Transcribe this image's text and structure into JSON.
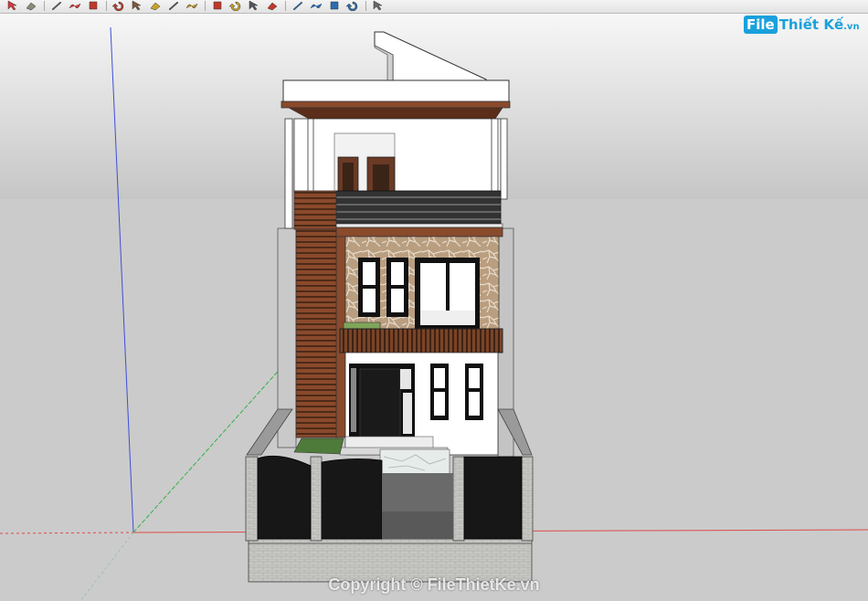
{
  "toolbar": {
    "tools": [
      {
        "icon": "select-arrow-icon",
        "color": "#d23a3a"
      },
      {
        "icon": "eraser-icon",
        "color": "#8a8a7a"
      },
      {
        "icon": "line-pencil-icon",
        "color": "#606060"
      },
      {
        "icon": "freehand-icon",
        "color": "#c23b3b"
      },
      {
        "icon": "push-pull-icon",
        "color": "#c0392b"
      },
      {
        "icon": "rotate-icon",
        "color": "#c0392b"
      },
      {
        "icon": "paint-bucket-icon",
        "color": "#7a5a3a"
      },
      {
        "icon": "tape-measure-icon",
        "color": "#c9a227"
      },
      {
        "icon": "dimension-icon",
        "color": "#555555"
      },
      {
        "icon": "text-icon",
        "color": "#b08a2a"
      },
      {
        "icon": "orbit-icon",
        "color": "#c0392b"
      },
      {
        "icon": "pan-hand-icon",
        "color": "#c9a227"
      },
      {
        "icon": "zoom-icon",
        "color": "#555555"
      },
      {
        "icon": "zoom-extents-icon",
        "color": "#c0392b"
      },
      {
        "icon": "previous-view-icon",
        "color": "#2b6cb0"
      },
      {
        "icon": "next-view-icon",
        "color": "#2b6cb0"
      },
      {
        "icon": "position-camera-icon",
        "color": "#2b6cb0"
      },
      {
        "icon": "walk-icon",
        "color": "#2b6cb0"
      },
      {
        "icon": "look-around-icon",
        "color": "#666666"
      }
    ]
  },
  "watermark": {
    "logo_badge": "File",
    "logo_text": "Thiết Kế",
    "logo_suffix": ".vn",
    "copyright": "Copyright © FileThietKe.vn"
  },
  "colors": {
    "sky": "#c7c7c7",
    "ground": "#cbcbcb",
    "axis_red": "#e04a4a",
    "axis_green": "#2fb24a",
    "axis_blue": "#3d4ed8",
    "stone": "#b79c7e",
    "timber": "#6b3a24",
    "logo_blue": "#1aa0dc"
  }
}
